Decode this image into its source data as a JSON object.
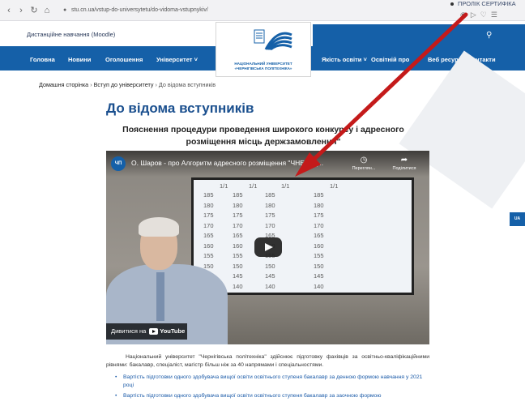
{
  "browser": {
    "url": "stu.cn.ua/vstup-do-universytetu/do-vidoma-vstupnykiv/",
    "cert_label": "ПРОЛІК СЕРТИФІКА"
  },
  "site": {
    "distance_label": "Дистанційне навчання (Moodle)",
    "logo_line1": "НАЦІОНАЛЬНИЙ УНІВЕРСИТЕТ",
    "logo_line2": "«ЧЕРНІГІВСЬКА ПОЛІТЕХНІКА»",
    "menu": [
      "Головна",
      "Новини",
      "Оголошення",
      "Університет",
      "Якість освіти",
      "Освітній про",
      "Веб ресурси",
      "Контакти"
    ],
    "lang_badge": "UA"
  },
  "breadcrumb": {
    "home": "Домашня сторінка",
    "parent": "Вступ до університету",
    "current": "До відома вступників"
  },
  "page": {
    "title": "До відома вступників",
    "subtitle_line1": "Пояснення процедури проведення широкого конкурсу і адресного",
    "subtitle_line2": "розміщення місць держзамовлення\""
  },
  "video": {
    "channel_initials": "ЧП",
    "title": "О. Шаров - про Алгоритм адресного розміщення \"ЧНЕ ВІД...",
    "watch_later": "Переглян...",
    "share": "Поділитися",
    "watch_on": "Дивитися на",
    "youtube": "YouTube",
    "board_headers": [
      "1/1",
      "1/1",
      "1/1",
      "1/1"
    ],
    "board_col1": [
      "185",
      "180",
      "175",
      "170",
      "165",
      "160",
      "155",
      "150",
      "145",
      "140"
    ],
    "board_col2": [
      "185",
      "180",
      "175",
      "170",
      "165",
      "160",
      "155",
      "150",
      "145",
      "140"
    ],
    "board_col3": [
      "185",
      "180",
      "175",
      "170",
      "165",
      "160",
      "155",
      "150",
      "145",
      "140"
    ],
    "board_col4": [
      "185",
      "180",
      "175",
      "170",
      "165",
      "160",
      "155",
      "150",
      "145",
      "140"
    ]
  },
  "content": {
    "paragraph": "Національний університет \"Чернігівська політехніка\" здійснює підготовку фахівців за освітньо-кваліфікаційними рівнями: бакалавр, спеціаліст, магістр більш ніж за 40 напрямами і спеціальностями.",
    "links": [
      "Вартість підготовки одного здобувача вищої освіти освітнього ступеня бакалавр за денною формою навчання у 2021 році",
      "Вартість підготовки одного здобувача вищої освіти освітнього ступеня бакалавр за заочною формою"
    ]
  }
}
